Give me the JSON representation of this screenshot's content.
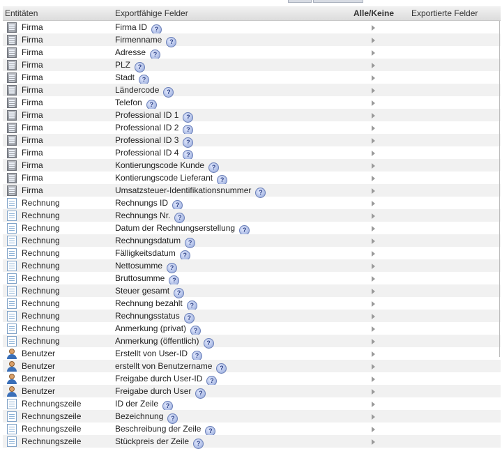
{
  "header": {
    "entities": "Entitäten",
    "exportable_fields": "Exportfähige Felder",
    "all_none": "Alle/Keine",
    "exported_fields": "Exportierte Felder"
  },
  "colors": {
    "header_bg": "#dcdcdc",
    "row_alt": "#f1f1f1",
    "help_icon": "#8ea3d8"
  },
  "rows": [
    {
      "entity": "Firma",
      "field": "Firma ID",
      "icon": "company-icon"
    },
    {
      "entity": "Firma",
      "field": "Firmenname",
      "icon": "company-icon"
    },
    {
      "entity": "Firma",
      "field": "Adresse",
      "icon": "company-icon"
    },
    {
      "entity": "Firma",
      "field": "PLZ",
      "icon": "company-icon"
    },
    {
      "entity": "Firma",
      "field": "Stadt",
      "icon": "company-icon"
    },
    {
      "entity": "Firma",
      "field": "Ländercode",
      "icon": "company-icon"
    },
    {
      "entity": "Firma",
      "field": "Telefon",
      "icon": "company-icon"
    },
    {
      "entity": "Firma",
      "field": "Professional ID 1",
      "icon": "company-icon"
    },
    {
      "entity": "Firma",
      "field": "Professional ID 2",
      "icon": "company-icon"
    },
    {
      "entity": "Firma",
      "field": "Professional ID 3",
      "icon": "company-icon"
    },
    {
      "entity": "Firma",
      "field": "Professional ID 4",
      "icon": "company-icon"
    },
    {
      "entity": "Firma",
      "field": "Kontierungscode Kunde",
      "icon": "company-icon"
    },
    {
      "entity": "Firma",
      "field": "Kontierungscode Lieferant",
      "icon": "company-icon"
    },
    {
      "entity": "Firma",
      "field": "Umsatzsteuer-Identifikationsnummer",
      "icon": "company-icon"
    },
    {
      "entity": "Rechnung",
      "field": "Rechnungs ID",
      "icon": "invoice-icon"
    },
    {
      "entity": "Rechnung",
      "field": "Rechnungs Nr.",
      "icon": "invoice-icon"
    },
    {
      "entity": "Rechnung",
      "field": "Datum der Rechnungserstellung",
      "icon": "invoice-icon"
    },
    {
      "entity": "Rechnung",
      "field": "Rechnungsdatum",
      "icon": "invoice-icon"
    },
    {
      "entity": "Rechnung",
      "field": "Fälligkeitsdatum",
      "icon": "invoice-icon"
    },
    {
      "entity": "Rechnung",
      "field": "Nettosumme",
      "icon": "invoice-icon"
    },
    {
      "entity": "Rechnung",
      "field": "Bruttosumme",
      "icon": "invoice-icon"
    },
    {
      "entity": "Rechnung",
      "field": "Steuer gesamt",
      "icon": "invoice-icon"
    },
    {
      "entity": "Rechnung",
      "field": "Rechnung bezahlt",
      "icon": "invoice-icon"
    },
    {
      "entity": "Rechnung",
      "field": "Rechnungsstatus",
      "icon": "invoice-icon"
    },
    {
      "entity": "Rechnung",
      "field": "Anmerkung (privat)",
      "icon": "invoice-icon"
    },
    {
      "entity": "Rechnung",
      "field": "Anmerkung (öffentlich)",
      "icon": "invoice-icon"
    },
    {
      "entity": "Benutzer",
      "field": "Erstellt von User-ID",
      "icon": "user-icon"
    },
    {
      "entity": "Benutzer",
      "field": "erstellt von Benutzername",
      "icon": "user-icon"
    },
    {
      "entity": "Benutzer",
      "field": "Freigabe durch User-ID",
      "icon": "user-icon"
    },
    {
      "entity": "Benutzer",
      "field": "Freigabe durch User",
      "icon": "user-icon"
    },
    {
      "entity": "Rechnungszeile",
      "field": "ID der Zeile",
      "icon": "invoice-line-icon"
    },
    {
      "entity": "Rechnungszeile",
      "field": "Bezeichnung",
      "icon": "invoice-line-icon"
    },
    {
      "entity": "Rechnungszeile",
      "field": "Beschreibung der Zeile",
      "icon": "invoice-line-icon"
    },
    {
      "entity": "Rechnungszeile",
      "field": "Stückpreis der Zeile",
      "icon": "invoice-line-icon"
    }
  ],
  "help_symbol": "?"
}
